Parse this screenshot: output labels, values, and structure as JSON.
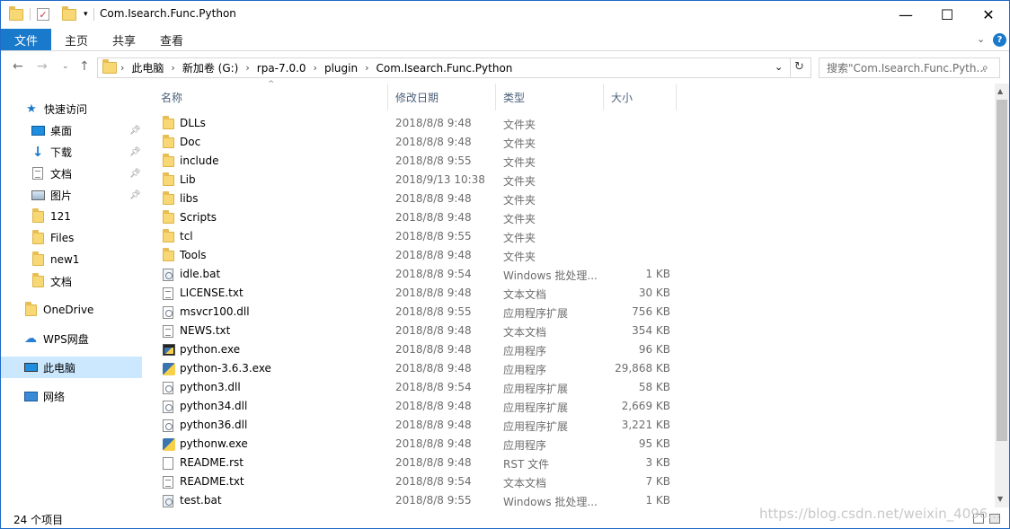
{
  "window": {
    "title": "Com.Isearch.Func.Python",
    "controls": {
      "minimize": "—",
      "maximize": "☐",
      "close": "✕"
    }
  },
  "ribbon": {
    "tabs": [
      "文件",
      "主页",
      "共享",
      "查看"
    ]
  },
  "address": {
    "path": [
      "此电脑",
      "新加卷 (G:)",
      "rpa-7.0.0",
      "plugin",
      "Com.Isearch.Func.Python"
    ],
    "search_placeholder": "搜索\"Com.Isearch.Func.Pyth..."
  },
  "navpane": {
    "quick_access": "快速访问",
    "pinned": [
      {
        "label": "桌面",
        "icon": "desktop-icon"
      },
      {
        "label": "下载",
        "icon": "download-icon"
      },
      {
        "label": "文档",
        "icon": "documents-icon"
      },
      {
        "label": "图片",
        "icon": "pictures-icon"
      }
    ],
    "folders": [
      "121",
      "Files",
      "new1",
      "文档"
    ],
    "onedrive": "OneDrive",
    "wps": "WPS网盘",
    "this_pc": "此电脑",
    "network": "网络"
  },
  "columns": {
    "name": "名称",
    "date": "修改日期",
    "type": "类型",
    "size": "大小"
  },
  "files": [
    {
      "name": "DLLs",
      "date": "2018/8/8 9:48",
      "type": "文件夹",
      "size": "",
      "icon": "folder"
    },
    {
      "name": "Doc",
      "date": "2018/8/8 9:48",
      "type": "文件夹",
      "size": "",
      "icon": "folder"
    },
    {
      "name": "include",
      "date": "2018/8/8 9:55",
      "type": "文件夹",
      "size": "",
      "icon": "folder"
    },
    {
      "name": "Lib",
      "date": "2018/9/13 10:38",
      "type": "文件夹",
      "size": "",
      "icon": "folder"
    },
    {
      "name": "libs",
      "date": "2018/8/8 9:48",
      "type": "文件夹",
      "size": "",
      "icon": "folder"
    },
    {
      "name": "Scripts",
      "date": "2018/8/8 9:48",
      "type": "文件夹",
      "size": "",
      "icon": "folder"
    },
    {
      "name": "tcl",
      "date": "2018/8/8 9:55",
      "type": "文件夹",
      "size": "",
      "icon": "folder"
    },
    {
      "name": "Tools",
      "date": "2018/8/8 9:48",
      "type": "文件夹",
      "size": "",
      "icon": "folder"
    },
    {
      "name": "idle.bat",
      "date": "2018/8/8 9:54",
      "type": "Windows 批处理...",
      "size": "1 KB",
      "icon": "bat"
    },
    {
      "name": "LICENSE.txt",
      "date": "2018/8/8 9:48",
      "type": "文本文档",
      "size": "30 KB",
      "icon": "txt"
    },
    {
      "name": "msvcr100.dll",
      "date": "2018/8/8 9:55",
      "type": "应用程序扩展",
      "size": "756 KB",
      "icon": "dll"
    },
    {
      "name": "NEWS.txt",
      "date": "2018/8/8 9:48",
      "type": "文本文档",
      "size": "354 KB",
      "icon": "txt"
    },
    {
      "name": "python.exe",
      "date": "2018/8/8 9:48",
      "type": "应用程序",
      "size": "96 KB",
      "icon": "exe"
    },
    {
      "name": "python-3.6.3.exe",
      "date": "2018/8/8 9:48",
      "type": "应用程序",
      "size": "29,868 KB",
      "icon": "py"
    },
    {
      "name": "python3.dll",
      "date": "2018/8/8 9:54",
      "type": "应用程序扩展",
      "size": "58 KB",
      "icon": "dll"
    },
    {
      "name": "python34.dll",
      "date": "2018/8/8 9:48",
      "type": "应用程序扩展",
      "size": "2,669 KB",
      "icon": "dll"
    },
    {
      "name": "python36.dll",
      "date": "2018/8/8 9:48",
      "type": "应用程序扩展",
      "size": "3,221 KB",
      "icon": "dll"
    },
    {
      "name": "pythonw.exe",
      "date": "2018/8/8 9:48",
      "type": "应用程序",
      "size": "95 KB",
      "icon": "py"
    },
    {
      "name": "README.rst",
      "date": "2018/8/8 9:48",
      "type": "RST 文件",
      "size": "3 KB",
      "icon": "blank"
    },
    {
      "name": "README.txt",
      "date": "2018/8/8 9:54",
      "type": "文本文档",
      "size": "7 KB",
      "icon": "txt"
    },
    {
      "name": "test.bat",
      "date": "2018/8/8 9:55",
      "type": "Windows 批处理...",
      "size": "1 KB",
      "icon": "bat"
    }
  ],
  "status": {
    "count": "24 个项目"
  },
  "watermark": "https://blog.csdn.net/weixin_4096..."
}
